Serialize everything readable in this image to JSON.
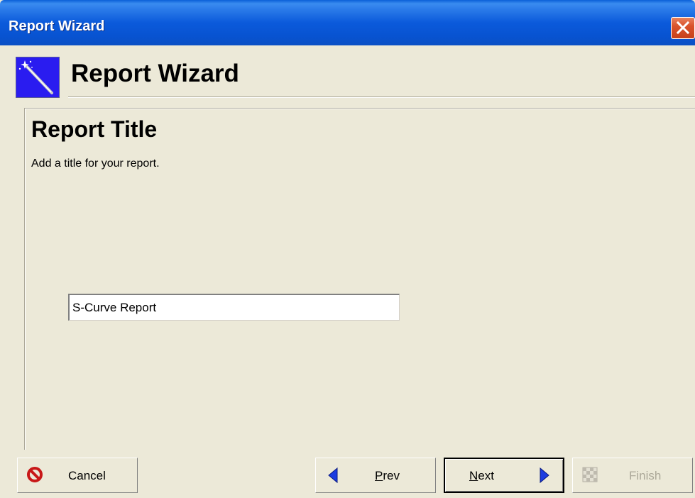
{
  "window": {
    "title": "Report Wizard",
    "close_icon": "close-icon"
  },
  "header": {
    "icon": "magic-wand-icon",
    "title": "Report Wizard"
  },
  "page": {
    "title": "Report Title",
    "description": "Add a title for your report.",
    "title_input": {
      "value": "S-Curve Report",
      "placeholder": ""
    }
  },
  "buttons": {
    "cancel": {
      "label": "Cancel",
      "icon": "cancel-icon",
      "enabled": true
    },
    "prev": {
      "label_first": "P",
      "label_rest": "rev",
      "icon": "arrow-left-icon",
      "enabled": true
    },
    "next": {
      "label_first": "N",
      "label_rest": "ext",
      "icon": "arrow-right-icon",
      "enabled": true,
      "default": true
    },
    "finish": {
      "label": "Finish",
      "icon": "checkered-flag-icon",
      "enabled": false
    }
  },
  "colors": {
    "title_bar": "#0A5FD8",
    "face": "#ECE9D8",
    "wizard_icon_bg": "#2A1CF0",
    "close_button": "#D9532C",
    "arrow": "#1C3CE0",
    "cancel_icon": "#C81818",
    "disabled_text": "#ACA899"
  }
}
